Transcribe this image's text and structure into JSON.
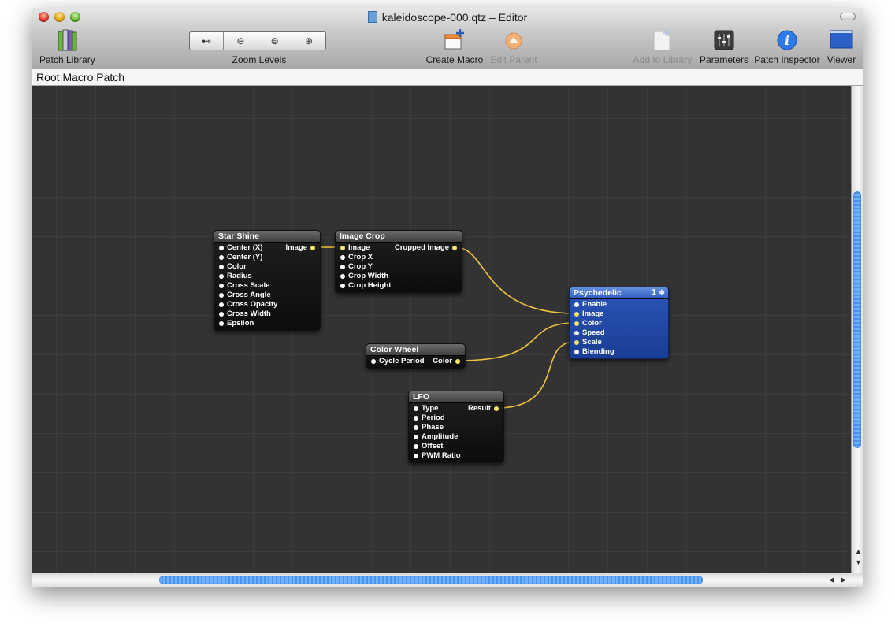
{
  "window": {
    "title": "kaleidoscope-000.qtz – Editor"
  },
  "toolbar": {
    "patch_library": "Patch Library",
    "zoom_levels": "Zoom Levels",
    "create_macro": "Create Macro",
    "edit_parent": "Edit Parent",
    "add_to_library": "Add to Library",
    "parameters": "Parameters",
    "patch_inspector": "Patch Inspector",
    "viewer": "Viewer",
    "zoom_buttons": [
      {
        "glyph": "⊷",
        "icon": "zoom-fit-icon"
      },
      {
        "glyph": "⊖",
        "icon": "zoom-out-icon"
      },
      {
        "glyph": "⊜",
        "icon": "zoom-actual-icon"
      },
      {
        "glyph": "⊕",
        "icon": "zoom-in-icon"
      }
    ]
  },
  "pathbar": {
    "label": "Root Macro Patch"
  },
  "patches": {
    "star_shine": {
      "title": "Star Shine",
      "inputs": [
        "Center (X)",
        "Center (Y)",
        "Color",
        "Radius",
        "Cross Scale",
        "Cross Angle",
        "Cross Opacity",
        "Cross Width",
        "Epsilon"
      ],
      "outputs": [
        "Image"
      ]
    },
    "image_crop": {
      "title": "Image Crop",
      "inputs": [
        "Image",
        "Crop X",
        "Crop Y",
        "Crop Width",
        "Crop Height"
      ],
      "outputs": [
        "Cropped Image"
      ]
    },
    "color_wheel": {
      "title": "Color Wheel",
      "inputs": [
        "Cycle Period"
      ],
      "outputs": [
        "Color"
      ]
    },
    "lfo": {
      "title": "LFO",
      "inputs": [
        "Type",
        "Period",
        "Phase",
        "Amplitude",
        "Offset",
        "PWM Ratio"
      ],
      "outputs": [
        "Result"
      ]
    },
    "psychedelic": {
      "title": "Psychedelic",
      "stepper": "1 ≑",
      "inputs": [
        "Enable",
        "Image",
        "Color",
        "Speed",
        "Scale",
        "Blending"
      ]
    }
  },
  "colors": {
    "canvas": "#333333",
    "wire": "#f2c53d",
    "consumer_patch": "#1a3d95"
  }
}
